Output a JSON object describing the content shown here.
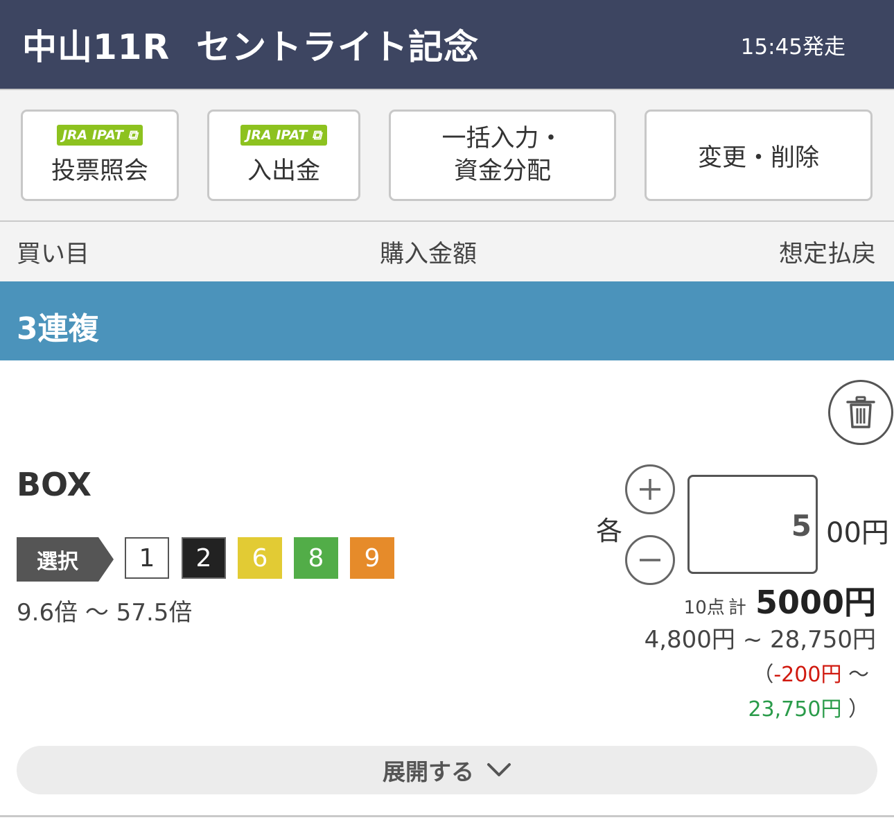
{
  "header": {
    "venue_race": "中山11R",
    "race_name": "セントライト記念",
    "post_time": "15:45発走"
  },
  "toolbar": {
    "inquiry": {
      "badge": "JRA IPAT",
      "label": "投票照会"
    },
    "deposit": {
      "badge": "JRA IPAT",
      "label": "入出金"
    },
    "bulk_line1": "一括入力・",
    "bulk_line2": "資金分配",
    "edit_label": "変更・削除"
  },
  "columns": {
    "bet": "買い目",
    "amount": "購入金額",
    "payout": "想定払戻"
  },
  "bet_type": "3連複",
  "ticket": {
    "method": "BOX",
    "select_label": "選択",
    "horses": [
      {
        "number": "1",
        "color": "#ffffff"
      },
      {
        "number": "2",
        "color": "#222222"
      },
      {
        "number": "6",
        "color": "#e2cb34"
      },
      {
        "number": "8",
        "color": "#52ad48"
      },
      {
        "number": "9",
        "color": "#e68b2a"
      }
    ],
    "odds_range": "9.6倍 〜 57.5倍",
    "each_label": "各",
    "amount_value": "5",
    "amount_unit": "00円",
    "points": "10点",
    "total_label": "計",
    "total": "5000円",
    "payout_range": "4,800円 ~ 28,750円",
    "profit_open": "（",
    "profit_min": "-200円",
    "profit_sep": "〜",
    "profit_max": "23,750円",
    "profit_close": "）"
  },
  "expand_label": "展開する"
}
